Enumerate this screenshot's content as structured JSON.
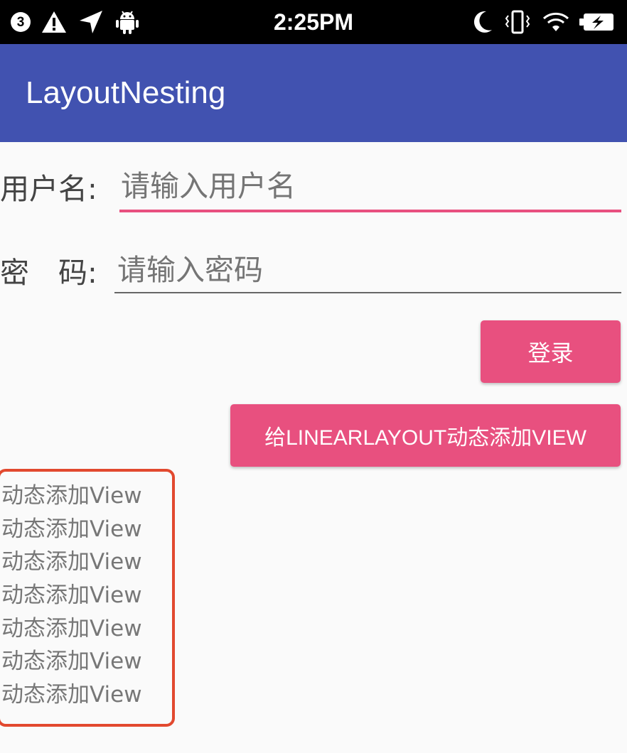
{
  "status_bar": {
    "time": "2:25PM",
    "notification_count": "3",
    "left_icons": [
      "notification-count-icon",
      "warning-icon",
      "location-arrow-icon",
      "android-icon"
    ],
    "right_icons": [
      "moon-icon",
      "vibrate-icon",
      "wifi-icon",
      "battery-charging-icon"
    ]
  },
  "app_bar": {
    "title": "LayoutNesting",
    "color": "#4152b0"
  },
  "form": {
    "username_label": "用户名:",
    "username_placeholder": "请输入用户名",
    "password_label": "密　码:",
    "password_placeholder": "请输入密码"
  },
  "buttons": {
    "login": "登录",
    "add_view": "给LINEARLAYOUT动态添加VIEW",
    "color": "#e8507f"
  },
  "dynamic_views": [
    "动态添加View",
    "动态添加View",
    "动态添加View",
    "动态添加View",
    "动态添加View",
    "动态添加View",
    "动态添加View"
  ],
  "highlight_color": "#e2492f"
}
